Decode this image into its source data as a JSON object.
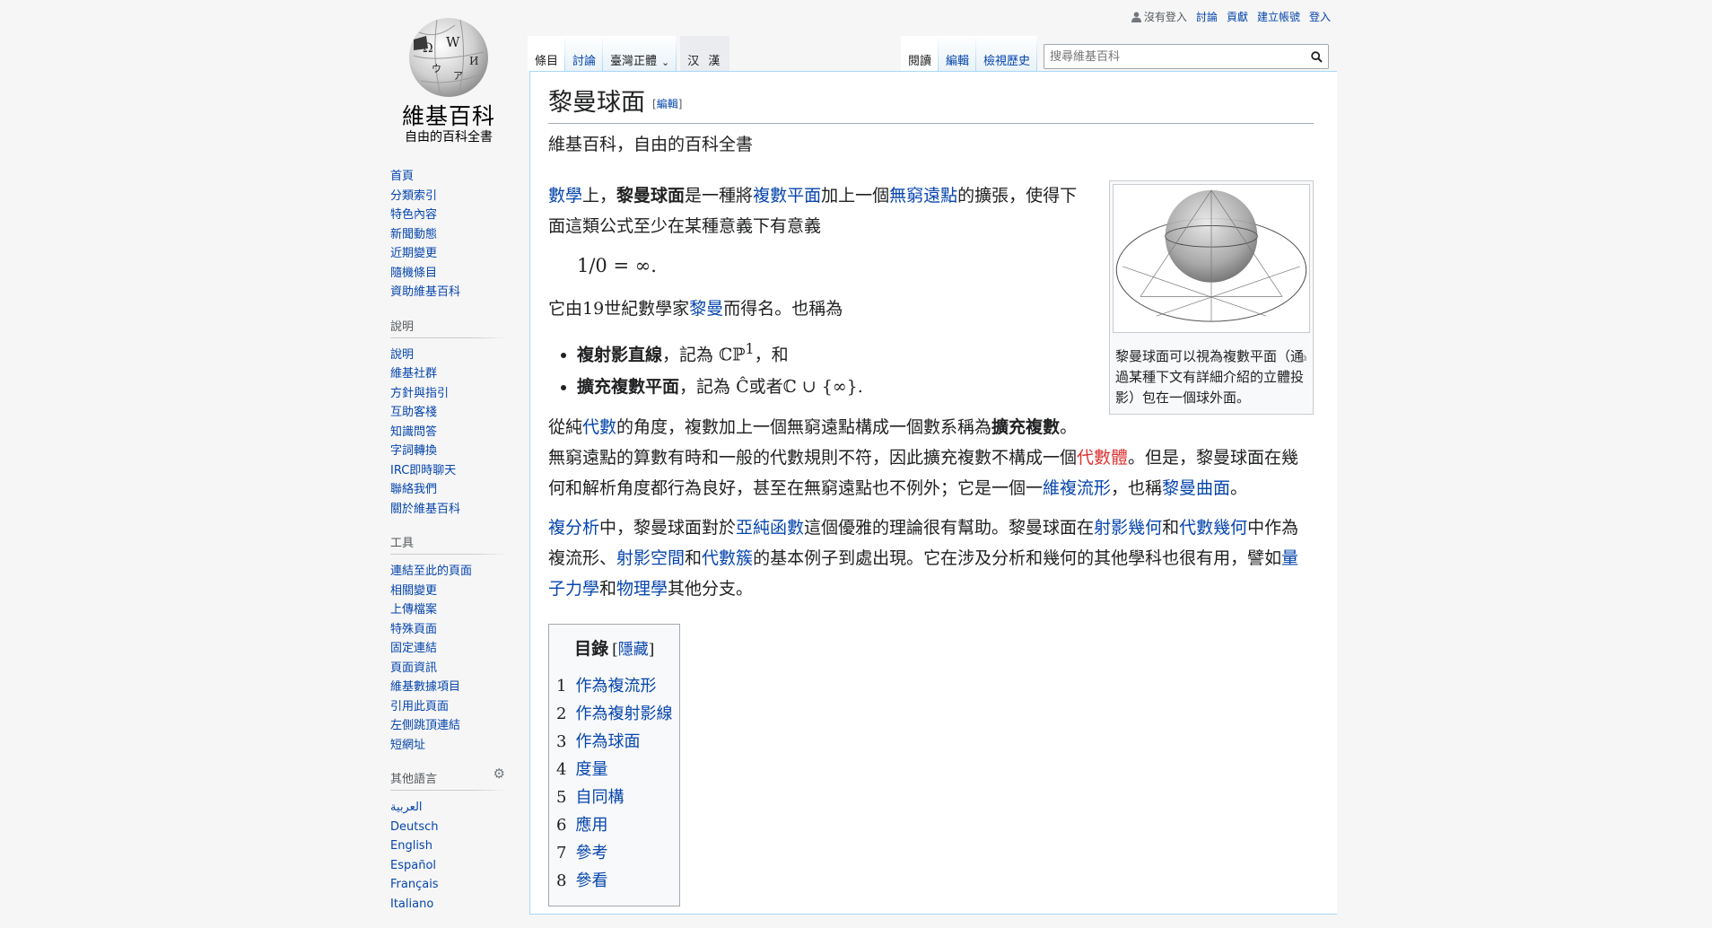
{
  "logo": {
    "wordmark": "維基百科",
    "tagline": "自由的百科全書"
  },
  "sidebar": {
    "navigation": [
      "首頁",
      "分類索引",
      "特色內容",
      "新聞動態",
      "近期變更",
      "隨機條目",
      "資助維基百科"
    ],
    "help": {
      "heading": "說明",
      "items": [
        "說明",
        "維基社群",
        "方針與指引",
        "互助客棧",
        "知識問答",
        "字詞轉換",
        "IRC即時聊天",
        "聯絡我們",
        "關於維基百科"
      ]
    },
    "tools": {
      "heading": "工具",
      "items": [
        "連結至此的頁面",
        "相關變更",
        "上傳檔案",
        "特殊頁面",
        "固定連結",
        "頁面資訊",
        "維基數據項目",
        "引用此頁面",
        "左側跳頂連結",
        "短網址"
      ]
    },
    "languages": {
      "heading": "其他語言",
      "items": [
        "العربية",
        "Deutsch",
        "English",
        "Español",
        "Français",
        "Italiano"
      ]
    }
  },
  "personal": {
    "not_logged_in": "沒有登入",
    "talk": "討論",
    "contributions": "貢獻",
    "create_account": "建立帳號",
    "login": "登入"
  },
  "tabs": {
    "article": "條目",
    "talk": "討論",
    "variant": "臺灣正體",
    "han": "汉 漢",
    "read": "閱讀",
    "edit": "編輯",
    "history": "檢視歷史"
  },
  "search": {
    "placeholder": "搜尋維基百科"
  },
  "article": {
    "title": "黎曼球面",
    "edit_label": "編輯",
    "site_sub": "維基百科，自由的百科全書",
    "p1": {
      "link1": "數學",
      "t1": "上，",
      "bold": "黎曼球面",
      "t2": "是一種將",
      "link2": "複數平面",
      "t3": "加上一個",
      "link3": "無窮遠點",
      "t4": "的擴張，使得下面這類公式至少在某種意義下有意義"
    },
    "formula": "1/0 = ∞.",
    "p2": {
      "t1": "它由19世紀數學家",
      "link": "黎曼",
      "t2": "而得名。也稱為"
    },
    "li1": {
      "bold": "複射影直線",
      "t1": "，記為 ",
      "math": "ℂℙ",
      "sup": "1",
      "t2": "，和"
    },
    "li2": {
      "bold": "擴充複數平面",
      "t1": "，記為 ",
      "math1": "Ĉ",
      "t2": "或者",
      "math2": "ℂ ∪ {∞}."
    },
    "p3": {
      "t1": "從純",
      "link1": "代數",
      "t2": "的角度，複數加上一個無窮遠點構成一個數系稱為",
      "bold": "擴充複數",
      "t3": "。無窮遠點的算數有時和一般的代數規則不符，因此擴充複數不構成一個",
      "redlink": "代數體",
      "t4": "。但是，黎曼球面在幾何和解析角度都行為良好，甚至在無窮遠點也不例外；它是一個一",
      "link2": "維複流形",
      "t5": "，也稱",
      "link3": "黎曼曲面",
      "t6": "。"
    },
    "p4": {
      "link1": "複分析",
      "t1": "中，黎曼球面對於",
      "link2": "亞純函數",
      "t2": "這個優雅的理論很有幫助。黎曼球面在",
      "link3": "射影幾何",
      "t3": "和",
      "link4": "代數幾何",
      "t4": "中作為複流形、",
      "link5": "射影空間",
      "t5": "和",
      "link6": "代數簇",
      "t6": "的基本例子到處出現。它在涉及分析和幾何的其他學科也很有用，譬如",
      "link7": "量子力學",
      "t7": "和",
      "link8": "物理學",
      "t8": "其他分支。"
    },
    "thumb_caption": "黎曼球面可以視為複數平面（通過某種下文有詳細介紹的立體投影）包在一個球外面。"
  },
  "toc": {
    "title": "目錄",
    "toggle": "隱藏",
    "items": [
      {
        "num": "1",
        "label": "作為複流形"
      },
      {
        "num": "2",
        "label": "作為複射影線"
      },
      {
        "num": "3",
        "label": "作為球面"
      },
      {
        "num": "4",
        "label": "度量"
      },
      {
        "num": "5",
        "label": "自同構"
      },
      {
        "num": "6",
        "label": "應用"
      },
      {
        "num": "7",
        "label": "參考"
      },
      {
        "num": "8",
        "label": "參看"
      }
    ]
  }
}
